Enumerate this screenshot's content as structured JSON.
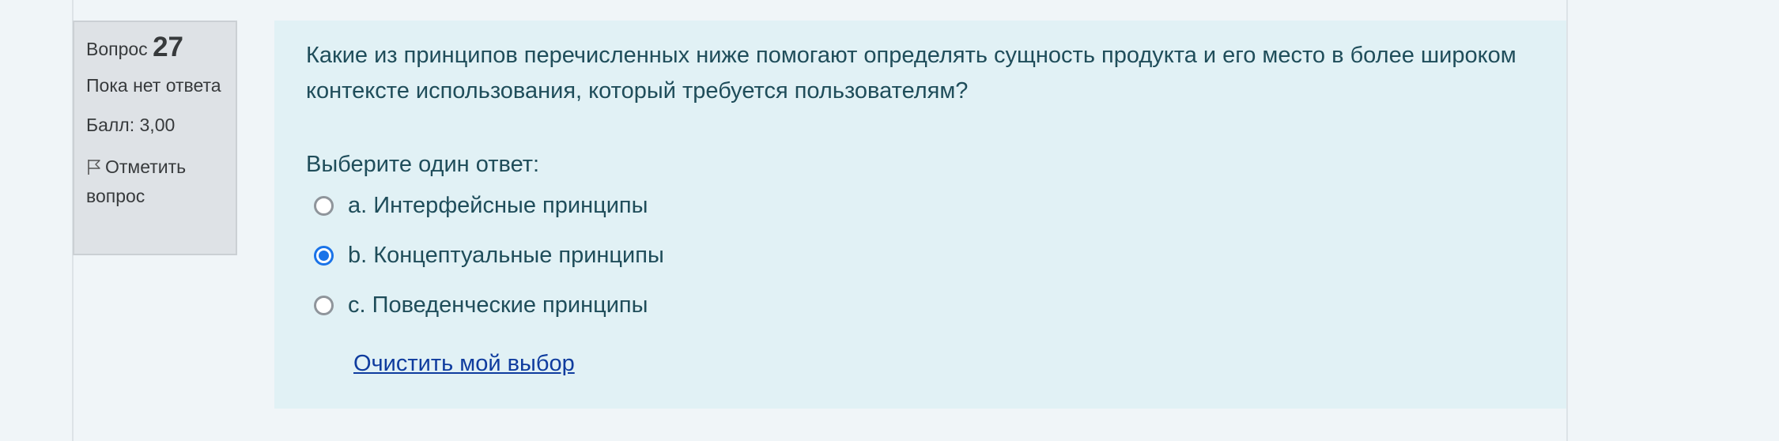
{
  "question_info": {
    "label": "Вопрос",
    "number": "27",
    "state": "Пока нет ответа",
    "grade": "Балл: 3,00",
    "flag_label": "Отметить вопрос",
    "flag_icon": "flag-outline-icon"
  },
  "question": {
    "text": "Какие из принципов перечисленных ниже помогают определять сущность продукта и его место в более широком контексте использования, который требуется пользователям?",
    "prompt": "Выберите один ответ:",
    "answers": [
      {
        "label": "a. Интерфейсные принципы",
        "checked": false
      },
      {
        "label": "b. Концептуальные принципы",
        "checked": true
      },
      {
        "label": "c. Поведенческие принципы",
        "checked": false
      }
    ],
    "clear_label": "Очистить мой выбор"
  },
  "colors": {
    "page_bg": "#f0f5f8",
    "info_bg": "#dee2e6",
    "content_bg": "#e1f1f5",
    "text": "#1f4d5a",
    "radio_checked": "#1a73e8",
    "link": "#0f3c9e"
  }
}
